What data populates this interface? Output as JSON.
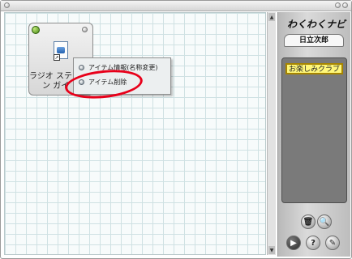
{
  "app": {
    "logo_text": "わくわくナビ",
    "user_name": "日立次郎"
  },
  "canvas": {
    "item": {
      "label_line1": "ラジオ ステー",
      "label_line2": "ン ガイ"
    },
    "context_menu": {
      "items": [
        {
          "label": "アイテム情報(名称変更)"
        },
        {
          "label": "アイテム削除"
        }
      ]
    },
    "annotation": {
      "highlighted_item": "アイテム削除"
    }
  },
  "sidebar": {
    "channels": [
      {
        "label": "お楽しみクラブ"
      }
    ],
    "buttons": {
      "help_label": "?"
    }
  },
  "colors": {
    "highlight_ring": "#e8001a",
    "channel_bg": "#fff77a",
    "grid_line": "#cfe1e3"
  }
}
